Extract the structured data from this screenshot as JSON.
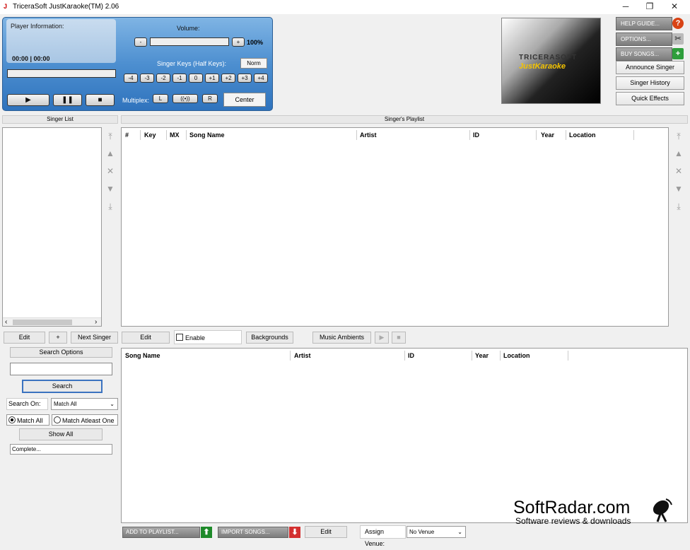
{
  "window": {
    "title": "TriceraSoft JustKaraoke(TM) 2.06",
    "app_icon": "J",
    "minimize": "─",
    "restore": "❐",
    "close": "✕"
  },
  "player": {
    "info_label": "Player Information:",
    "time": "00:00 | 00:00",
    "volume_label": "Volume:",
    "volume_minus": "-",
    "volume_plus": "+",
    "volume_value": "100%",
    "singer_keys_label": "Singer Keys (Half Keys):",
    "norm": "Norm",
    "keys": [
      "-4",
      "-3",
      "-2",
      "-1",
      "0",
      "+1",
      "+2",
      "+3",
      "+4"
    ],
    "play": "▶",
    "pause": "❚❚",
    "stop": "■",
    "multiplex_label": "Multiplex:",
    "mp_left": "L",
    "mp_both": "((•))",
    "mp_right": "R",
    "center": "Center"
  },
  "logo": {
    "line1": "TRICERASOFT",
    "line2": "JustKaraoke"
  },
  "right_buttons": {
    "help": "HELP GUIDE...",
    "options": "OPTIONS...",
    "buy": "BUY SONGS...",
    "announce": "Announce Singer",
    "history": "Singer History",
    "effects": "Quick Effects"
  },
  "singer_list": {
    "header": "Singer List",
    "scroll_left": "‹",
    "scroll_right": "›"
  },
  "playlist": {
    "header": "Singer's Playlist",
    "columns": [
      "#",
      "Key",
      "MX",
      "Song Name",
      "Artist",
      "ID",
      "Year",
      "Location"
    ]
  },
  "mid_buttons": {
    "edit_singer": "Edit",
    "add_singer": "+",
    "next_singer": "Next Singer",
    "edit_playlist": "Edit",
    "enable": "Enable",
    "backgrounds": "Backgrounds",
    "music_ambients": "Music Ambients",
    "amb_play": "▶",
    "amb_stop": "■"
  },
  "search": {
    "options_header": "Search Options",
    "search_button": "Search",
    "search_on_label": "Search On:",
    "search_on_value": "Match All",
    "match_all": "Match All",
    "match_atleast_one": "Match Atleast One",
    "show_all": "Show All",
    "status": "Complete..."
  },
  "songs": {
    "columns": [
      "Song Name",
      "Artist",
      "ID",
      "Year",
      "Location"
    ]
  },
  "bottom": {
    "add_to_playlist": "ADD TO PLAYLIST...",
    "import_songs": "IMPORT SONGS...",
    "edit": "Edit",
    "assign_venue_label": "Assign Venue:",
    "venue_value": "No Venue"
  },
  "watermark": {
    "brand": "SoftRadar.com",
    "tagline": "Software reviews & downloads"
  }
}
